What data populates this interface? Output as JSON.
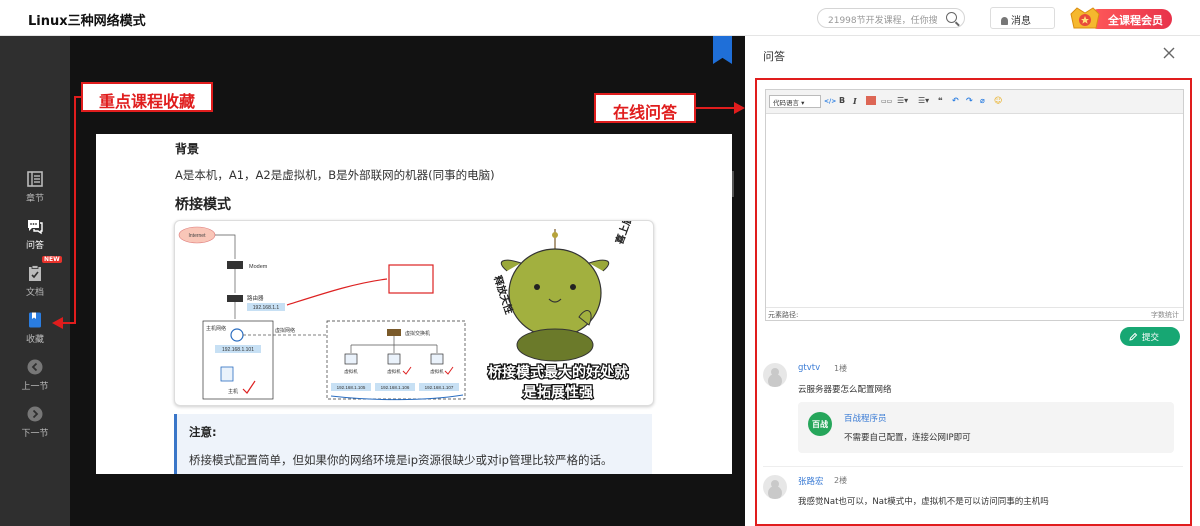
{
  "header": {
    "course_title": "Linux三种网络模式",
    "search_placeholder": "21998节开发课程，任你搜",
    "messages_label": "消息",
    "vip_label": "全课程会员"
  },
  "sidebar": {
    "items": [
      {
        "label": "章节",
        "icon": "chapters-icon"
      },
      {
        "label": "问答",
        "icon": "qa-icon"
      },
      {
        "label": "文档",
        "icon": "document-icon",
        "badge": "NEW"
      },
      {
        "label": "收藏",
        "icon": "bookmark-icon"
      },
      {
        "label": "上一节",
        "icon": "prev-icon"
      },
      {
        "label": "下一节",
        "icon": "next-icon"
      }
    ],
    "active_index": 1
  },
  "annotations": {
    "bookmark_callout": "重点课程收藏",
    "qa_callout": "在线问答",
    "color": "#e01d1d"
  },
  "slide": {
    "heading": "背景",
    "paragraph": "A是本机，A1，A2是虚拟机，B是外部联网的机器(同事的电脑)",
    "section_title": "桥接模式",
    "diagram": {
      "internet": "Internet",
      "modem": "Modem",
      "router": "路由器",
      "router_ip": "192.168.1.1",
      "host_nic": "主机网络",
      "host_ip": "192.168.1.101",
      "host": "主机",
      "virtual_net": "虚拟网络",
      "virtual_switch": "虚拟交换机",
      "vm_label": "虚拟机",
      "vm_ips": [
        "192.168.1.105",
        "192.168.1.106",
        "192.168.1.107"
      ],
      "meme_side_left": "释放天性",
      "meme_side_right": "喜上眉梢",
      "meme_caption_line1": "桥接模式最大的好处就",
      "meme_caption_line2": "是拓展性强"
    },
    "note_title": "注意:",
    "note_text": "桥接模式配置简单，但如果你的网络环境是ip资源很缺少或对ip管理比较严格的话。"
  },
  "qa_panel": {
    "title": "问答",
    "editor": {
      "language_select": "代码语言",
      "path_label": "元素路径:",
      "word_count_label": "字数统计"
    },
    "submit_label": "提交",
    "accent_color": "#17a773",
    "comments": [
      {
        "user": "gtvtv",
        "floor": "1楼",
        "text": "云服务器要怎么配置网络",
        "reply": {
          "avatar_text": "百战",
          "user": "百战程序员",
          "text": "不需要自己配置，连接公网IP即可"
        }
      },
      {
        "user": "张路宏",
        "floor": "2楼",
        "text": "我感觉Nat也可以，Nat模式中，虚拟机不是可以访问同事的主机吗"
      }
    ]
  }
}
